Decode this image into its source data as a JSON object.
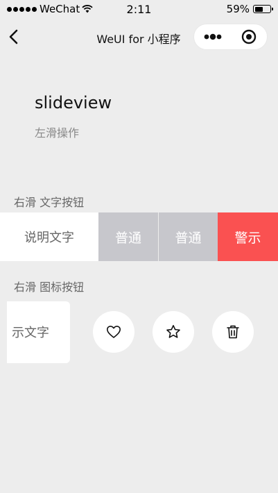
{
  "status_bar": {
    "carrier": "WeChat",
    "time": "2:11",
    "battery_text": "59%",
    "battery_level": 0.59,
    "signal_icon": "signal-dots-icon",
    "wifi_icon": "wifi-icon"
  },
  "nav": {
    "title": "WeUI for 小程序",
    "back_icon": "chevron-left-icon",
    "menu_icon": "more-dots-icon",
    "close_icon": "target-circle-icon"
  },
  "page": {
    "title": "slideview",
    "desc": "左滑操作"
  },
  "text_section": {
    "label": "右滑 文字按钮",
    "content": "说明文字",
    "buttons": [
      "普通",
      "普通",
      "警示"
    ]
  },
  "icon_section": {
    "label": "右滑 图标按钮",
    "content": "示文字",
    "buttons": [
      "heart-icon",
      "star-icon",
      "trash-icon"
    ]
  },
  "colors": {
    "background": "#ededed",
    "default_button": "#c7c7cc",
    "warn_button": "#fa5151"
  }
}
